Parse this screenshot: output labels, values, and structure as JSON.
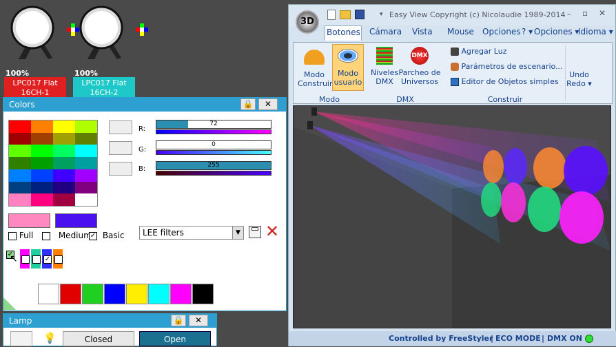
{
  "fixtures": [
    {
      "pct": "100%",
      "line1": "LPC017 Flat",
      "line2": "16CH-1",
      "color": "#e02020"
    },
    {
      "pct": "100%",
      "line1": "LPC017 Flat",
      "line2": "16CH-2",
      "color": "#1ec8c8"
    }
  ],
  "colors_window": {
    "title": "Colors",
    "palette": [
      "#ff0000",
      "#ff8000",
      "#ffff00",
      "#b0ff00",
      "#a00000",
      "#a04000",
      "#a0a000",
      "#608000",
      "#60ff00",
      "#00ff00",
      "#00ff60",
      "#00ffff",
      "#308000",
      "#00a000",
      "#00a060",
      "#00a0a0",
      "#0080ff",
      "#0040ff",
      "#4000ff",
      "#a000ff",
      "#004080",
      "#002080",
      "#200080",
      "#800080",
      "#ff80c0",
      "#ff0080",
      "#a00040",
      "#ffffff"
    ],
    "r_label": "R:",
    "g_label": "G:",
    "b_label": "B:",
    "r_value": "72",
    "g_value": "0",
    "b_value": "255",
    "full_swatch": "#ff88c0",
    "current_swatch": "#4a10f0",
    "full_label": "Full",
    "medium_label": "Medium",
    "basic_label": "Basic",
    "filter_value": "LEE filters",
    "basic_colors": [
      "#ffffff",
      "#e00000",
      "#20d020",
      "#0000ff",
      "#ffee00",
      "#00ffff",
      "#ff00ff",
      "#000000"
    ]
  },
  "lamp_window": {
    "title": "Lamp",
    "closed_label": "Closed",
    "open_label": "Open"
  },
  "easyview": {
    "title": "Easy View   Copyright (c) Nicolaudie 1989-2014",
    "logo": "3D",
    "tabs": [
      "Botones e",
      "Cámara",
      "Vista",
      "Mouse",
      "Opciones",
      "? ▾",
      "Opciones ▾",
      "Idioma ▾"
    ],
    "btn_construir": "Modo Construir",
    "btn_usuario": "Modo usuario",
    "btn_niveles": "Niveles DMX",
    "btn_parcheo": "Parcheo de Universos",
    "btn_agregar": "Agregar Luz",
    "btn_parametros": "Parámetros de escenario...",
    "btn_editor": "Editor de Objetos simples",
    "btn_undo": "Undo Redo ▾",
    "group_modo": "Modo",
    "group_dmx": "DMX",
    "group_construir": "Construir",
    "status_controlled": "Controlled by FreeStyler",
    "status_eco": "ECO MODE",
    "status_dmx": "DMX ON"
  }
}
